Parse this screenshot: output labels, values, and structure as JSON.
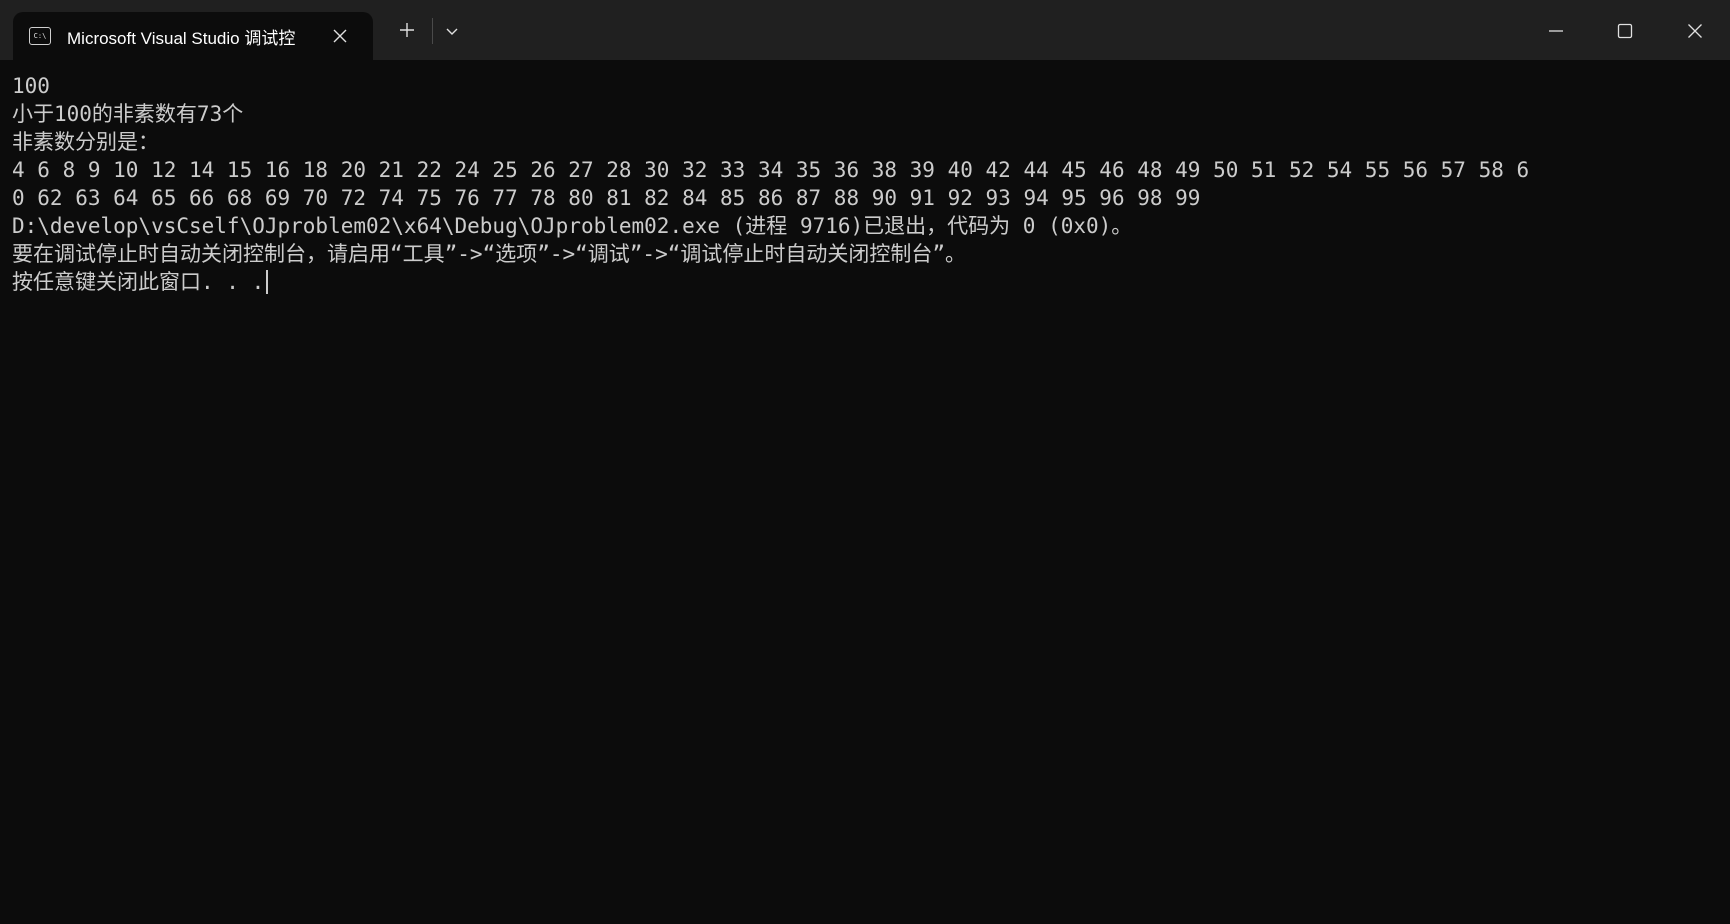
{
  "titlebar": {
    "tab_title": "Microsoft Visual Studio 调试控",
    "tab_icon_text": "C:\\",
    "icons": {
      "tab": "terminal-icon",
      "close_tab": "close-icon",
      "new_tab": "plus-icon",
      "dropdown": "chevron-down-icon",
      "minimize": "minimize-icon",
      "maximize": "maximize-icon",
      "close_window": "close-icon"
    }
  },
  "console": {
    "lines": [
      "100",
      "小于100的非素数有73个",
      "非素数分别是：",
      "4 6 8 9 10 12 14 15 16 18 20 21 22 24 25 26 27 28 30 32 33 34 35 36 38 39 40 42 44 45 46 48 49 50 51 52 54 55 56 57 58 6",
      "0 62 63 64 65 66 68 69 70 72 74 75 76 77 78 80 81 82 84 85 86 87 88 90 91 92 93 94 95 96 98 99",
      "D:\\develop\\vsCself\\OJproblem02\\x64\\Debug\\OJproblem02.exe (进程 9716)已退出，代码为 0 (0x0)。",
      "要在调试停止时自动关闭控制台，请启用“工具”->“选项”->“调试”->“调试停止时自动关闭控制台”。",
      "按任意键关闭此窗口. . ."
    ]
  },
  "colors": {
    "background": "#0c0c0c",
    "titlebar": "#202020",
    "text": "#cccccc"
  }
}
